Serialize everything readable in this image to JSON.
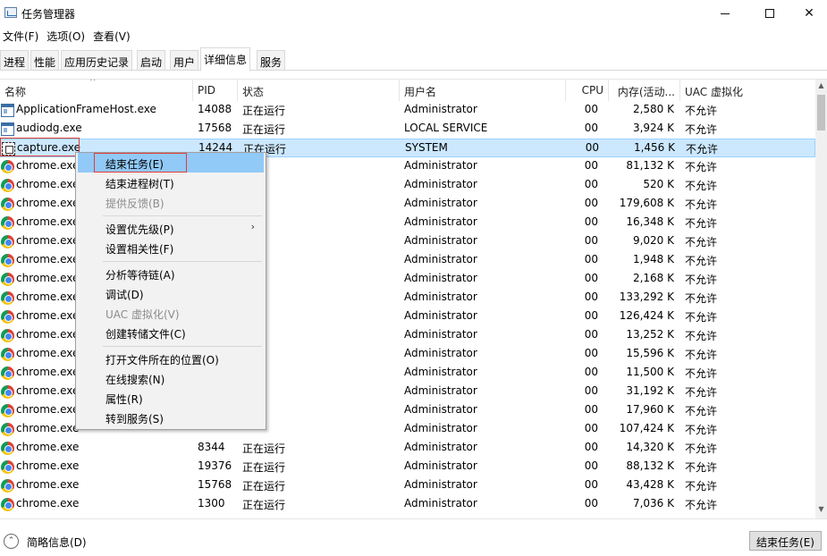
{
  "window": {
    "title": "任务管理器"
  },
  "menu": [
    "文件(F)",
    "选项(O)",
    "查看(V)"
  ],
  "tabs": [
    "进程",
    "性能",
    "应用历史记录",
    "启动",
    "用户",
    "详细信息",
    "服务"
  ],
  "active_tab": "详细信息",
  "columns": {
    "name": "名称",
    "pid": "PID",
    "status": "状态",
    "user": "用户名",
    "cpu": "CPU",
    "memory": "内存(活动...",
    "uac": "UAC 虚拟化"
  },
  "rows": [
    {
      "icon": "window",
      "name": "ApplicationFrameHost.exe",
      "pid": "14088",
      "status": "正在运行",
      "user": "Administrator",
      "cpu": "00",
      "memory": "2,580 K",
      "uac": "不允许"
    },
    {
      "icon": "window",
      "name": "audiodg.exe",
      "pid": "17568",
      "status": "正在运行",
      "user": "LOCAL SERVICE",
      "cpu": "00",
      "memory": "3,924 K",
      "uac": "不允许"
    },
    {
      "icon": "capture",
      "name": "capture.exe",
      "pid": "14244",
      "status": "正在运行",
      "user": "SYSTEM",
      "cpu": "00",
      "memory": "1,456 K",
      "uac": "不允许",
      "selected": true
    },
    {
      "icon": "chrome",
      "name": "chrome.exe",
      "pid": "",
      "status": "",
      "user": "Administrator",
      "cpu": "00",
      "memory": "81,132 K",
      "uac": "不允许"
    },
    {
      "icon": "chrome",
      "name": "chrome.exe",
      "pid": "",
      "status": "",
      "user": "Administrator",
      "cpu": "00",
      "memory": "520 K",
      "uac": "不允许"
    },
    {
      "icon": "chrome",
      "name": "chrome.exe",
      "pid": "",
      "status": "",
      "user": "Administrator",
      "cpu": "00",
      "memory": "179,608 K",
      "uac": "不允许"
    },
    {
      "icon": "chrome",
      "name": "chrome.exe",
      "pid": "",
      "status": "",
      "user": "Administrator",
      "cpu": "00",
      "memory": "16,348 K",
      "uac": "不允许"
    },
    {
      "icon": "chrome",
      "name": "chrome.exe",
      "pid": "",
      "status": "",
      "user": "Administrator",
      "cpu": "00",
      "memory": "9,020 K",
      "uac": "不允许"
    },
    {
      "icon": "chrome",
      "name": "chrome.exe",
      "pid": "",
      "status": "",
      "user": "Administrator",
      "cpu": "00",
      "memory": "1,948 K",
      "uac": "不允许"
    },
    {
      "icon": "chrome",
      "name": "chrome.exe",
      "pid": "",
      "status": "",
      "user": "Administrator",
      "cpu": "00",
      "memory": "2,168 K",
      "uac": "不允许"
    },
    {
      "icon": "chrome",
      "name": "chrome.exe",
      "pid": "",
      "status": "",
      "user": "Administrator",
      "cpu": "00",
      "memory": "133,292 K",
      "uac": "不允许"
    },
    {
      "icon": "chrome",
      "name": "chrome.exe",
      "pid": "",
      "status": "",
      "user": "Administrator",
      "cpu": "00",
      "memory": "126,424 K",
      "uac": "不允许"
    },
    {
      "icon": "chrome",
      "name": "chrome.exe",
      "pid": "",
      "status": "",
      "user": "Administrator",
      "cpu": "00",
      "memory": "13,252 K",
      "uac": "不允许"
    },
    {
      "icon": "chrome",
      "name": "chrome.exe",
      "pid": "",
      "status": "",
      "user": "Administrator",
      "cpu": "00",
      "memory": "15,596 K",
      "uac": "不允许"
    },
    {
      "icon": "chrome",
      "name": "chrome.exe",
      "pid": "",
      "status": "",
      "user": "Administrator",
      "cpu": "00",
      "memory": "11,500 K",
      "uac": "不允许"
    },
    {
      "icon": "chrome",
      "name": "chrome.exe",
      "pid": "",
      "status": "",
      "user": "Administrator",
      "cpu": "00",
      "memory": "31,192 K",
      "uac": "不允许"
    },
    {
      "icon": "chrome",
      "name": "chrome.exe",
      "pid": "",
      "status": "",
      "user": "Administrator",
      "cpu": "00",
      "memory": "17,960 K",
      "uac": "不允许"
    },
    {
      "icon": "chrome",
      "name": "chrome.exe",
      "pid": "",
      "status": "",
      "user": "Administrator",
      "cpu": "00",
      "memory": "107,424 K",
      "uac": "不允许"
    },
    {
      "icon": "chrome",
      "name": "chrome.exe",
      "pid": "8344",
      "status": "正在运行",
      "user": "Administrator",
      "cpu": "00",
      "memory": "14,320 K",
      "uac": "不允许"
    },
    {
      "icon": "chrome",
      "name": "chrome.exe",
      "pid": "19376",
      "status": "正在运行",
      "user": "Administrator",
      "cpu": "00",
      "memory": "88,132 K",
      "uac": "不允许"
    },
    {
      "icon": "chrome",
      "name": "chrome.exe",
      "pid": "15768",
      "status": "正在运行",
      "user": "Administrator",
      "cpu": "00",
      "memory": "43,428 K",
      "uac": "不允许"
    },
    {
      "icon": "chrome",
      "name": "chrome.exe",
      "pid": "1300",
      "status": "正在运行",
      "user": "Administrator",
      "cpu": "00",
      "memory": "7,036 K",
      "uac": "不允许"
    }
  ],
  "context_menu": [
    {
      "label": "结束任务(E)",
      "highlight": true
    },
    {
      "label": "结束进程树(T)"
    },
    {
      "label": "提供反馈(B)",
      "disabled": true
    },
    {
      "separator": true
    },
    {
      "label": "设置优先级(P)",
      "submenu": true
    },
    {
      "label": "设置相关性(F)"
    },
    {
      "separator": true
    },
    {
      "label": "分析等待链(A)"
    },
    {
      "label": "调试(D)"
    },
    {
      "label": "UAC 虚拟化(V)",
      "disabled": true
    },
    {
      "label": "创建转储文件(C)"
    },
    {
      "separator": true
    },
    {
      "label": "打开文件所在的位置(O)"
    },
    {
      "label": "在线搜索(N)"
    },
    {
      "label": "属性(R)"
    },
    {
      "label": "转到服务(S)"
    }
  ],
  "footer": {
    "brief_label": "简略信息(D)",
    "end_task_label": "结束任务(E)"
  },
  "colors": {
    "selection": "#cce8ff",
    "menu_highlight": "#91c9f7",
    "focus_red": "#e03c3c"
  }
}
